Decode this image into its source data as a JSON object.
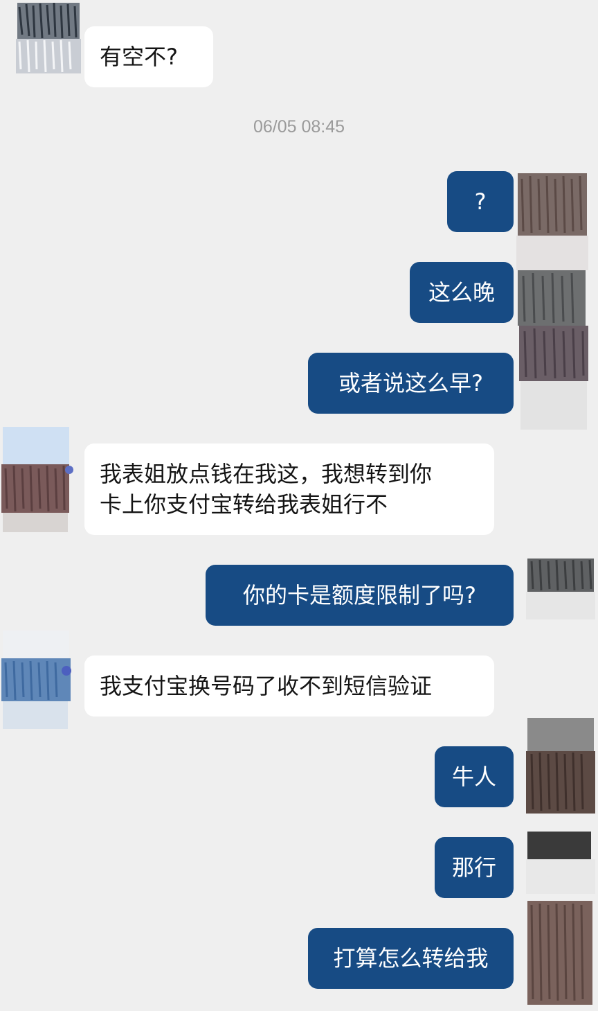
{
  "timestamp": "06/05 08:45",
  "messages": [
    {
      "side": "in",
      "text": "有空不?"
    },
    {
      "side": "out",
      "text": "?"
    },
    {
      "side": "out",
      "text": "这么晚"
    },
    {
      "side": "out",
      "text": "或者说这么早?"
    },
    {
      "side": "in",
      "lines": [
        "我表姐放点钱在我这，我想转到你",
        "卡上你支付宝转给我表姐行不"
      ]
    },
    {
      "side": "out",
      "text": "你的卡是额度限制了吗?"
    },
    {
      "side": "in",
      "text": "我支付宝换号码了收不到短信验证"
    },
    {
      "side": "out",
      "text": "牛人"
    },
    {
      "side": "out",
      "text": "那行"
    },
    {
      "side": "out",
      "text": "打算怎么转给我"
    }
  ],
  "colors": {
    "background": "#efefef",
    "incoming_bubble": "#ffffff",
    "outgoing_bubble": "#174b84",
    "timestamp_text": "#9a9a9a"
  }
}
